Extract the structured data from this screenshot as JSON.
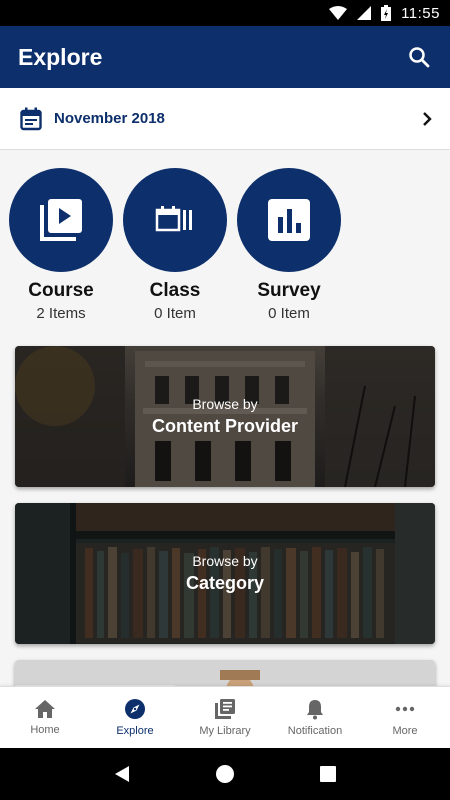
{
  "status_bar": {
    "time": "11:55",
    "icons": [
      "wifi-icon",
      "signal-icon",
      "battery-charging-icon"
    ]
  },
  "app_bar": {
    "title": "Explore",
    "search_icon": "search-icon"
  },
  "date_bar": {
    "label": "November 2018",
    "calendar_icon": "calendar-icon",
    "next_icon": "chevron-right-icon"
  },
  "categories": [
    {
      "title": "Course",
      "count": "2 Items",
      "icon": "video-library-icon"
    },
    {
      "title": "Class",
      "count": "0 Item",
      "icon": "class-icon"
    },
    {
      "title": "Survey",
      "count": "0 Item",
      "icon": "bar-chart-icon"
    }
  ],
  "cards": [
    {
      "subtitle": "Browse by",
      "title": "Content Provider"
    },
    {
      "subtitle": "Browse by",
      "title": "Category"
    }
  ],
  "bottom_nav": [
    {
      "label": "Home",
      "icon": "home-icon",
      "active": false
    },
    {
      "label": "Explore",
      "icon": "compass-icon",
      "active": true
    },
    {
      "label": "My Library",
      "icon": "library-icon",
      "active": false
    },
    {
      "label": "Notification",
      "icon": "bell-icon",
      "active": false
    },
    {
      "label": "More",
      "icon": "more-horizontal-icon",
      "active": false
    }
  ],
  "colors": {
    "primary": "#0d2f6b",
    "background": "#f5f5f5",
    "inactive": "#666666"
  }
}
